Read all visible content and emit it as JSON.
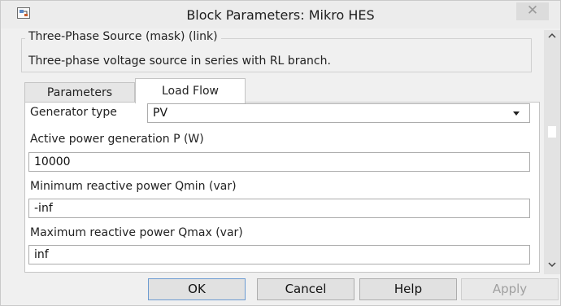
{
  "window": {
    "title": "Block Parameters: Mikro HES",
    "close_glyph": "✕"
  },
  "mask": {
    "group_title": "Three-Phase Source (mask) (link)",
    "description": "Three-phase voltage source in series with RL branch."
  },
  "tabs": [
    {
      "label": "Parameters",
      "selected": false
    },
    {
      "label": "Load Flow",
      "selected": true
    }
  ],
  "fields": {
    "generator_type": {
      "label": "Generator type",
      "value": "PV"
    },
    "active_power": {
      "label": "Active power generation P (W)",
      "value": "10000"
    },
    "qmin": {
      "label": "Minimum reactive power Qmin (var)",
      "value": "-inf"
    },
    "qmax": {
      "label": "Maximum reactive power Qmax (var)",
      "value": "inf"
    }
  },
  "buttons": {
    "ok": "OK",
    "cancel": "Cancel",
    "help": "Help",
    "apply": "Apply"
  },
  "icons": {
    "app": "block-parameters-icon",
    "close": "close-icon",
    "dropdown": "chevron-down-icon",
    "scroll_up": "scroll-up-arrow-icon",
    "scroll_down": "scroll-down-arrow-icon"
  },
  "colors": {
    "window_bg": "#f0f0f0",
    "panel_bg": "#ffffff",
    "ok_border": "#6c9bd1",
    "disabled_text": "#a0a0a0"
  }
}
